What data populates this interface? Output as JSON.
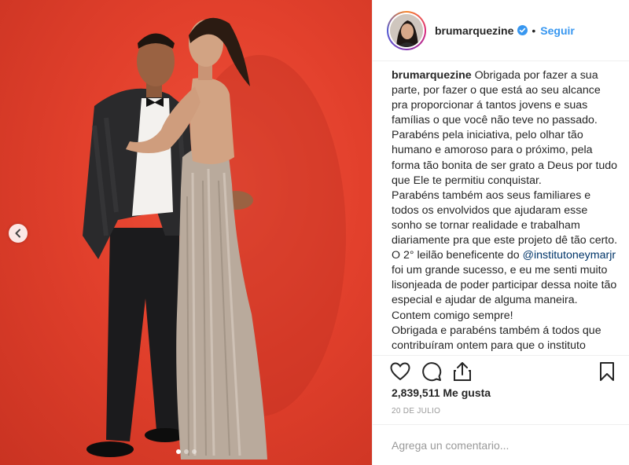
{
  "post": {
    "username": "brumarquezine",
    "follow_label": "Seguir",
    "separator": "•",
    "caption_author": "brumarquezine",
    "caption_part1": " Obrigada por fazer a sua parte, por fazer o que está ao seu alcance pra proporcionar á tantos jovens e suas famílias o que você não teve no passado. Parabéns pela iniciativa, pelo olhar tão humano e amoroso para o próximo, pela forma tão bonita de ser grato a Deus por tudo que Ele te permitiu conquistar.\nParabéns também aos seus familiares e todos os envolvidos que ajudaram esse sonho se tornar realidade e trabalham diariamente pra que este projeto dê tão certo.\nO 2° leilão beneficente do ",
    "caption_mention": "@institutoneymarjr",
    "caption_part2": " foi um grande sucesso, e eu me senti muito lisonjeada de poder participar dessa noite tão especial e ajudar de alguma maneira. Contem comigo sempre!\nObrigada e parabéns também á todos que contribuíram ontem para que o instituto",
    "likes_label": "2,839,511 Me gusta",
    "date_label": "20 DE JULIO",
    "comment_placeholder": "Agrega un comentario..."
  },
  "carousel": {
    "slides": 3,
    "active_index": 0
  },
  "icons": {
    "verified": "verified-badge-icon",
    "like": "heart-icon",
    "comment": "comment-icon",
    "share": "share-icon",
    "save": "bookmark-icon",
    "prev": "chevron-left-icon"
  },
  "colors": {
    "link": "#3897f0",
    "mention": "#003569",
    "muted": "#999999",
    "photo_background": "#e2402c"
  }
}
